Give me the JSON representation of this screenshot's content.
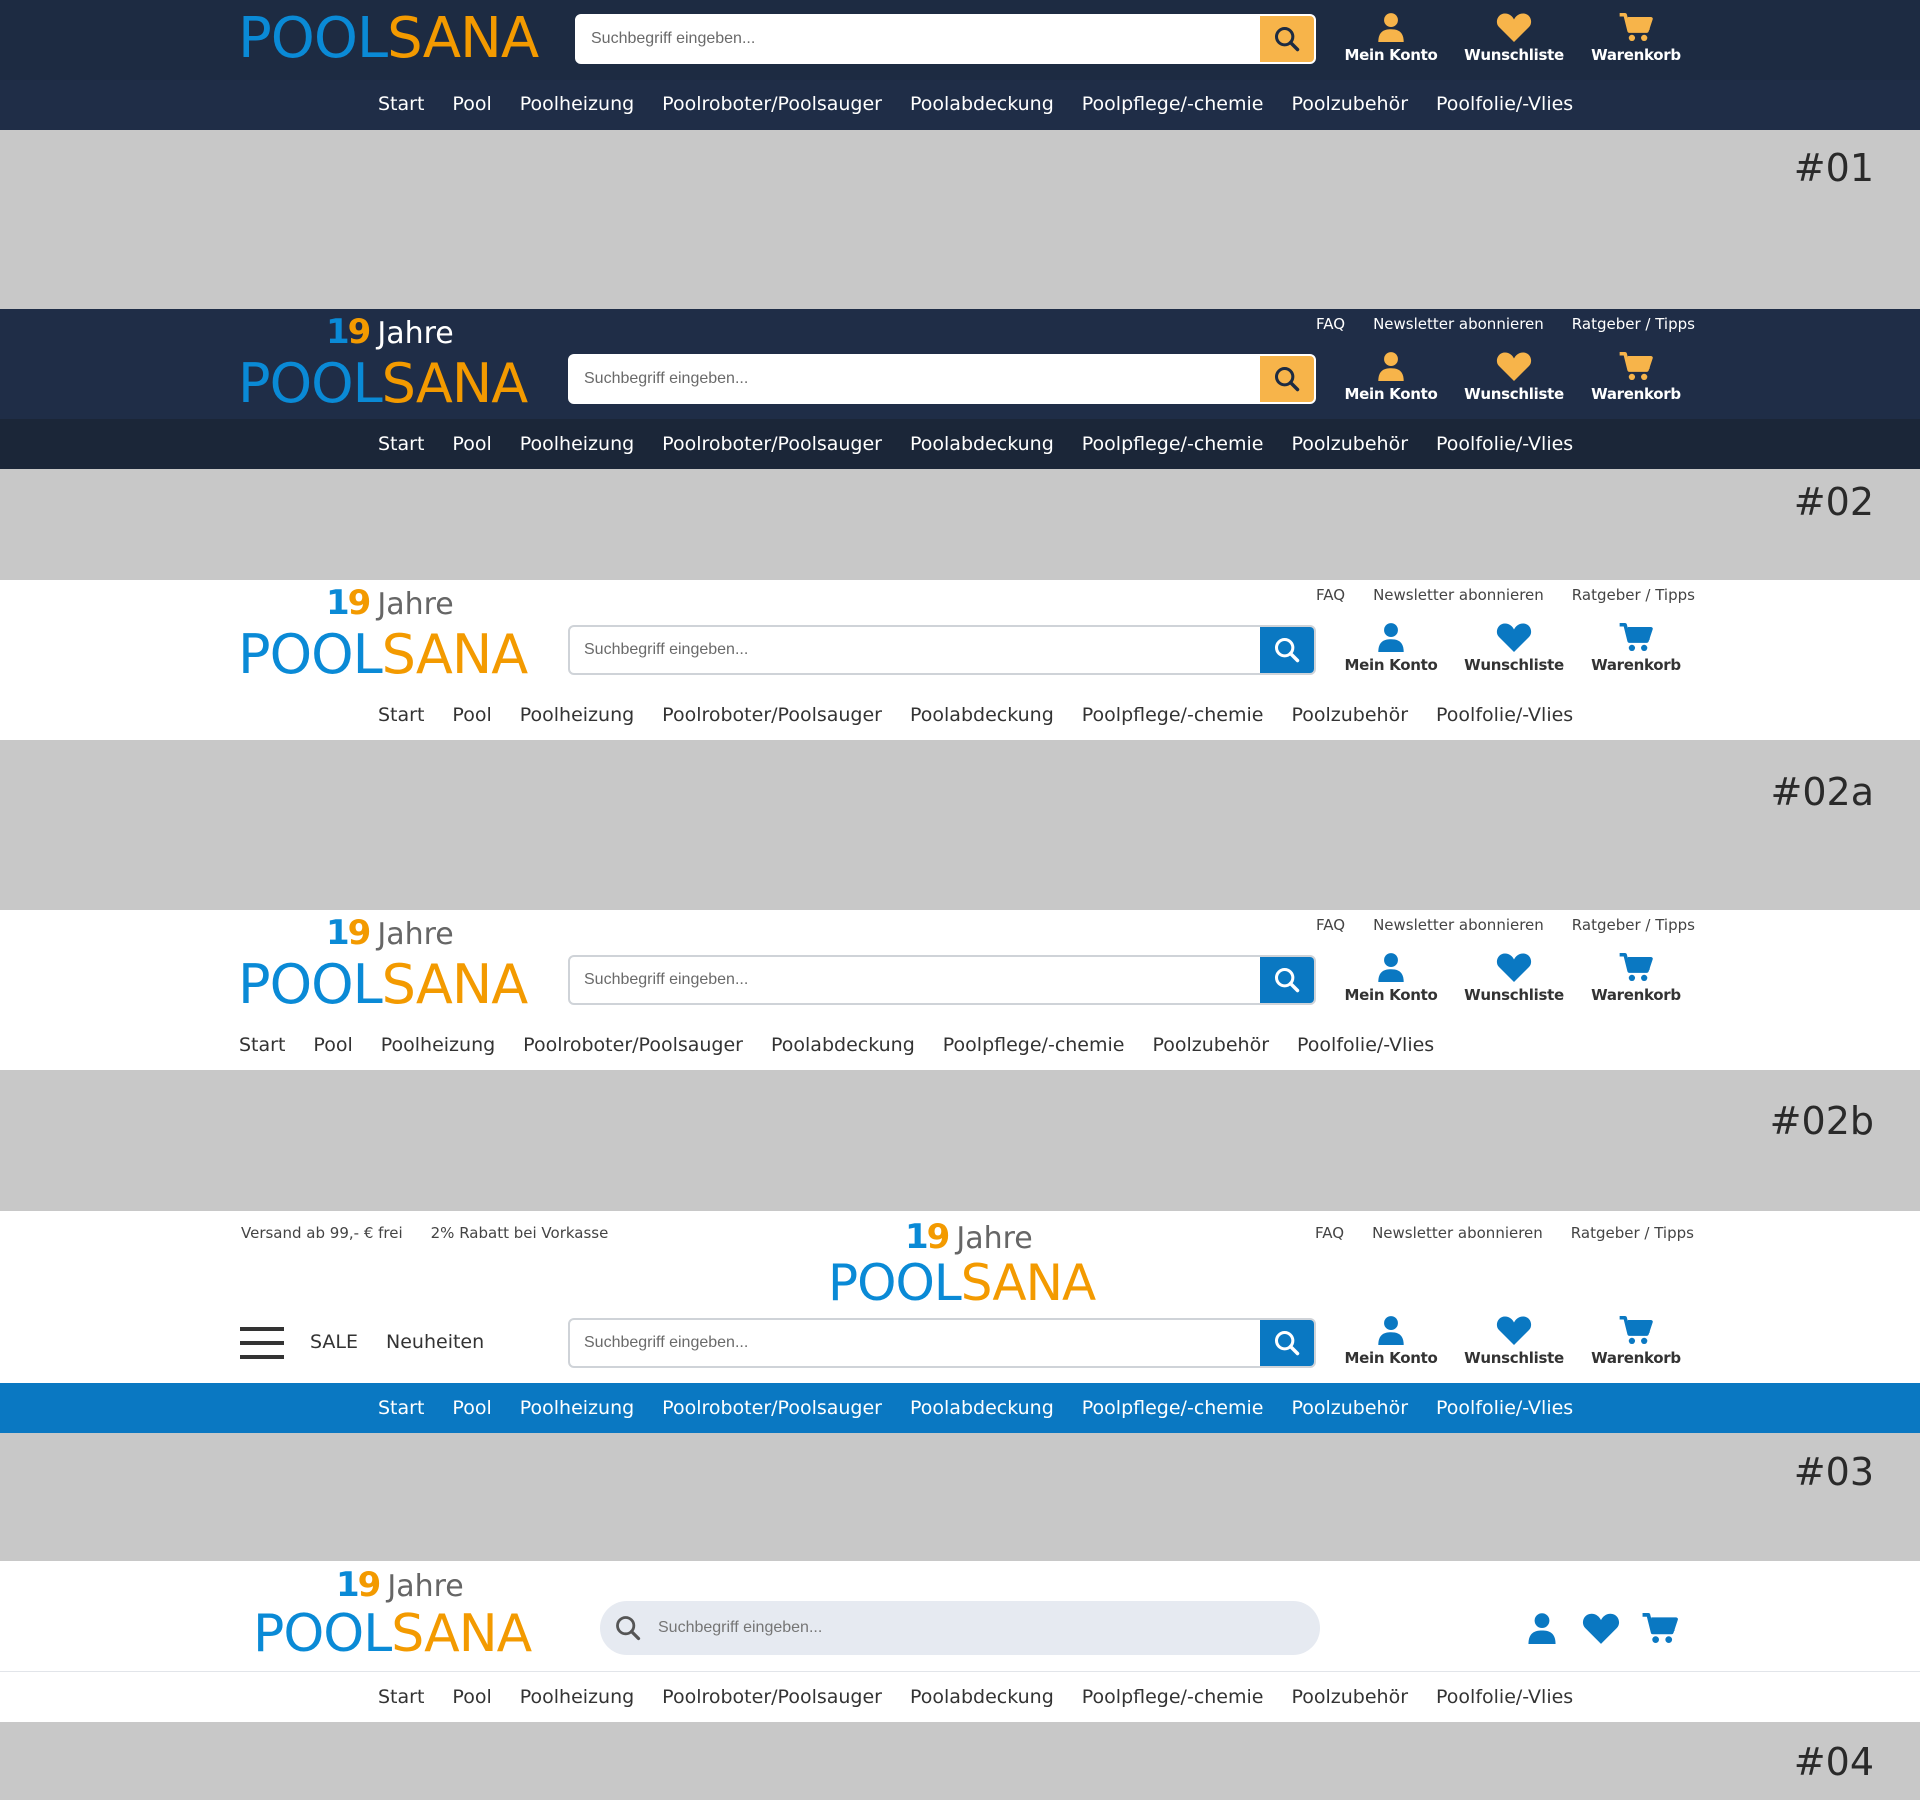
{
  "brand": {
    "logo_part1": "POOL",
    "logo_part2": "SANA",
    "years_d1": "1",
    "years_d2": "9",
    "years_text": "Jahre"
  },
  "search": {
    "placeholder": "Suchbegriff eingeben..."
  },
  "actions": {
    "account": "Mein Konto",
    "wishlist": "Wunschliste",
    "cart": "Warenkorb"
  },
  "nav": [
    "Start",
    "Pool",
    "Poolheizung",
    "Poolroboter/Poolsauger",
    "Poolabdeckung",
    "Poolpflege/-chemie",
    "Poolzubehör",
    "Poolfolie/-Vlies"
  ],
  "toplinks": [
    "FAQ",
    "Newsletter abonnieren",
    "Ratgeber / Tipps"
  ],
  "usp": [
    "Versand ab 99,- € frei",
    "2% Rabatt bei Vorkasse"
  ],
  "quicklinks": [
    "SALE",
    "Neuheiten"
  ],
  "variants": [
    "#01",
    "#02",
    "#02a",
    "#02b",
    "#03",
    "#04"
  ],
  "colors": {
    "dark_navy": "#1d2b42",
    "accent_yellow": "#f7b44a",
    "accent_blue": "#0a78c2",
    "logo_blue": "#0a8ad6",
    "logo_orange": "#f39a00",
    "page_gray": "#c8c8c8"
  }
}
